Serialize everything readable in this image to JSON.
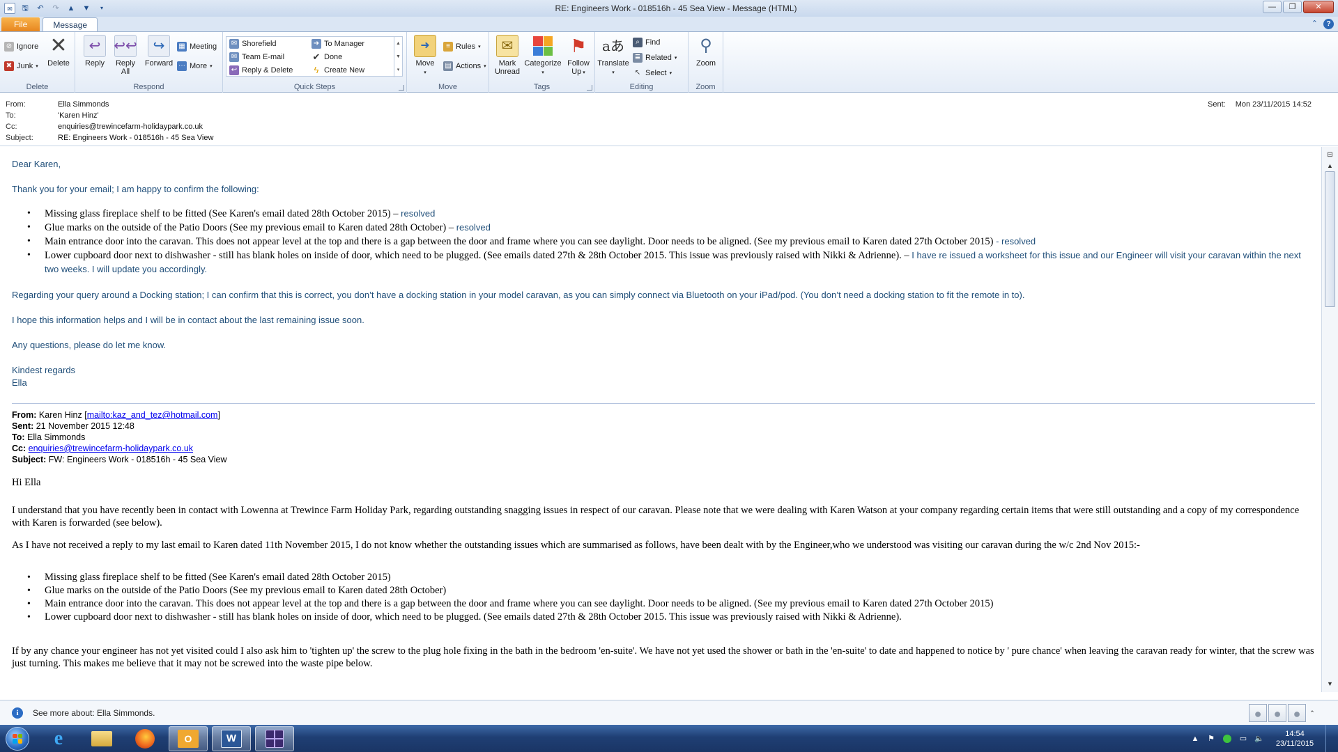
{
  "window": {
    "title": "RE: Engineers Work - 018516h - 45 Sea View - Message (HTML)"
  },
  "tabs": {
    "file": "File",
    "message": "Message"
  },
  "ribbon": {
    "delete_group": {
      "label": "Delete",
      "ignore": "Ignore",
      "junk": "Junk",
      "delete": "Delete"
    },
    "respond_group": {
      "label": "Respond",
      "reply": "Reply",
      "reply_all_1": "Reply",
      "reply_all_2": "All",
      "forward": "Forward",
      "meeting": "Meeting",
      "more": "More"
    },
    "quick_steps_group": {
      "label": "Quick Steps",
      "items": [
        "Shorefield",
        "To Manager",
        "Team E-mail",
        "Done",
        "Reply & Delete",
        "Create New"
      ]
    },
    "move_group": {
      "label": "Move",
      "move": "Move",
      "rules": "Rules",
      "actions": "Actions"
    },
    "tags_group": {
      "label": "Tags",
      "mark_unread_1": "Mark",
      "mark_unread_2": "Unread",
      "categorize": "Categorize",
      "follow_up_1": "Follow",
      "follow_up_2": "Up"
    },
    "editing_group": {
      "label": "Editing",
      "translate": "Translate",
      "find": "Find",
      "related": "Related",
      "select": "Select"
    },
    "zoom_group": {
      "label": "Zoom",
      "zoom": "Zoom"
    }
  },
  "header": {
    "from_label": "From:",
    "from": "Ella Simmonds",
    "to_label": "To:",
    "to": "'Karen Hinz'",
    "cc_label": "Cc:",
    "cc": "enquiries@trewincefarm-holidaypark.co.uk",
    "subject_label": "Subject:",
    "subject": "RE: Engineers Work - 018516h - 45 Sea View",
    "sent_label": "Sent:",
    "sent": "Mon 23/11/2015 14:52"
  },
  "reply": {
    "greeting": "Dear Karen,",
    "intro": "Thank you for your email; I am happy to confirm the following:",
    "items": [
      {
        "text": "Missing glass fireplace shelf to be fitted  (See Karen's email dated 28th October 2015) –",
        "status": " resolved"
      },
      {
        "text": "Glue marks on the outside of the Patio Doors (See my previous email to Karen dated 28th October) –",
        "status": " resolved"
      },
      {
        "text": "Main entrance door into the caravan. This does not appear level at the top and there is a gap between the door and frame where you can see daylight. Door needs to be aligned. (See my previous email to Karen dated 27th October 2015)",
        "status": " - resolved"
      },
      {
        "text": "Lower cupboard door next to dishwasher - still has blank holes on inside of door, which need to be plugged. (See emails dated 27th & 28th October 2015. This issue was previously raised with Nikki & Adrienne). –",
        "status": " I have re issued a worksheet for this issue and our Engineer will visit your caravan within the next two weeks. I will update you accordingly."
      }
    ],
    "docking": "Regarding your query around a Docking station; I can confirm that this is correct, you don’t have a docking station in your model caravan, as you can simply connect via Bluetooth on your iPad/pod. (You don’t need a docking station to fit the remote in to).",
    "hope": "I hope this information helps and I will be in contact about the last remaining issue soon.",
    "questions": "Any questions, please do let me know.",
    "regards": "Kindest regards",
    "signature": "Ella"
  },
  "forwarded": {
    "from_label": "From:",
    "from_name": "Karen Hinz [",
    "from_link": "mailto:kaz_and_tez@hotmail.com",
    "from_end": "]",
    "sent_label": "Sent:",
    "sent": "21 November 2015 12:48",
    "to_label": "To:",
    "to": "Ella Simmonds",
    "cc_label": "Cc:",
    "cc_link": "enquiries@trewincefarm-holidaypark.co.uk",
    "subject_label": "Subject:",
    "subject": "FW: Engineers Work - 018516h - 45 Sea View",
    "greeting": "Hi Ella",
    "para1": "I understand that you have recently been in contact with Lowenna at Trewince Farm Holiday Park, regarding outstanding snagging issues in respect of our caravan. Please note that we were dealing with Karen Watson at your company regarding certain items that were still outstanding and a copy of my correspondence with Karen is forwarded (see below).",
    "para2": "As I have not received a reply to my last email to Karen dated 11th November 2015, I do not know whether the outstanding issues which are summarised as follows, have been dealt with by the Engineer,who we understood was visiting our caravan during the w/c 2nd Nov 2015:-",
    "items": [
      "Missing glass fireplace shelf to be fitted  (See Karen's email dated 28th October 2015)",
      "Glue marks on the outside of the Patio Doors (See my previous email to Karen dated 28th October)",
      "Main entrance door into the caravan. This does not appear level at the top and there is a gap between the door and frame where you can see daylight. Door needs to be aligned. (See my previous email to Karen dated 27th October 2015)",
      "Lower cupboard door next to dishwasher - still has blank holes on inside of door, which need to be plugged. (See emails dated 27th & 28th October 2015. This issue was previously raised with Nikki & Adrienne)."
    ],
    "para3": "If by any chance your engineer has not yet visited could I also ask him to 'tighten up' the screw to the plug hole fixing in the bath in the bedroom 'en-suite'. We have not yet used the shower or bath in the 'en-suite' to date and happened to notice by ' pure chance' when leaving the caravan ready for winter, that the screw was just turning. This makes me believe that it may not be screwed into the waste pipe below."
  },
  "people_pane": {
    "text": "See more about: Ella Simmonds."
  },
  "taskbar": {
    "time": "14:54",
    "date": "23/11/2015"
  },
  "colors": {
    "reply_text": "#1f4e79",
    "file_tab": "#e7861f",
    "taskbar": "#1f3f74"
  }
}
